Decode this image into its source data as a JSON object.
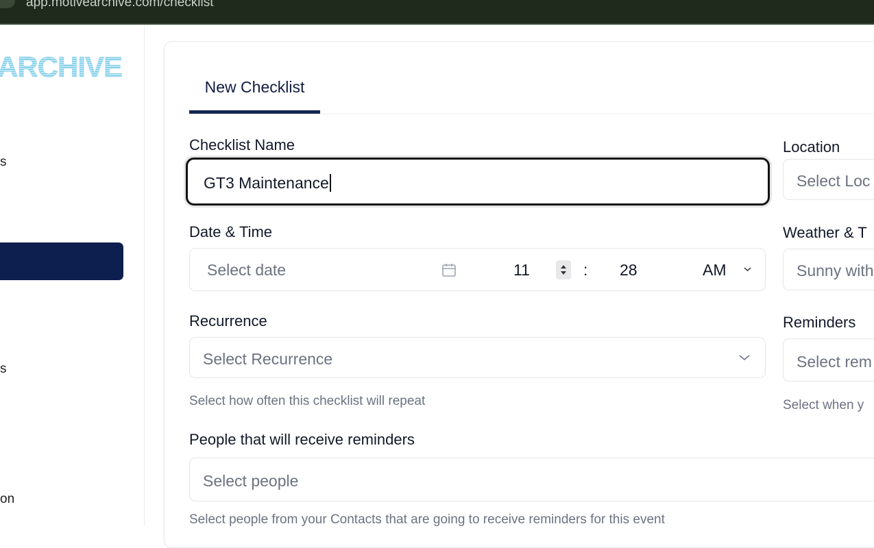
{
  "browser": {
    "url": "app.motivearchive.com/checklist"
  },
  "sidebar": {
    "logo_text": "ARCHIVE",
    "fragments": [
      "s",
      "s",
      "on"
    ]
  },
  "tabs": [
    {
      "label": "New Checklist",
      "active": true
    }
  ],
  "form": {
    "checklist_name": {
      "label": "Checklist Name",
      "value": "GT3 Maintenance"
    },
    "date_time": {
      "label": "Date & Time",
      "date_placeholder": "Select date",
      "hour": "11",
      "separator": ":",
      "minute": "28",
      "period": "AM"
    },
    "recurrence": {
      "label": "Recurrence",
      "placeholder": "Select Recurrence",
      "help": "Select how often this checklist will repeat"
    },
    "people": {
      "label": "People that will receive reminders",
      "placeholder": "Select people",
      "help": "Select people from your Contacts that are going to receive reminders for this event"
    },
    "location": {
      "label": "Location",
      "placeholder": "Select Loc"
    },
    "weather": {
      "label": "Weather & T",
      "placeholder": "Sunny with"
    },
    "reminders": {
      "label": "Reminders",
      "placeholder": "Select rem",
      "help": "Select when y"
    }
  },
  "colors": {
    "accent": "#0d1f4f",
    "tab_underline": "#14264f",
    "logo": "#a9def1"
  },
  "icons": {
    "calendar": "calendar-icon",
    "chevron": "chevron-down-icon",
    "stepper": "stepper-icon"
  }
}
